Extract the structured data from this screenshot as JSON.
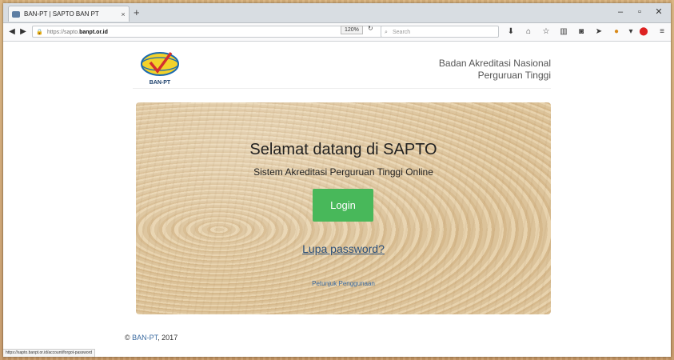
{
  "browser": {
    "tab_title": "BAN-PT | SAPTO BAN PT",
    "tab_close": "×",
    "new_tab": "+",
    "url_prefix": "https://sapto.",
    "url_host": "banpt.or.id",
    "zoom": "120%",
    "search_placeholder": "Search",
    "status_url": "https://sapto.banpt.or.id/account/forgot-password"
  },
  "header": {
    "logo_text": "BAN-PT",
    "org_line1": "Badan Akreditasi Nasional",
    "org_line2": "Perguruan Tinggi"
  },
  "hero": {
    "welcome": "Selamat datang di SAPTO",
    "subtitle": "Sistem Akreditasi Perguruan Tinggi Online",
    "login_label": "Login",
    "forgot_label": "Lupa password?",
    "guide_label": "Petunjuk Penggunaan"
  },
  "footer": {
    "copyright_symbol": "©",
    "org": "BAN-PT",
    "year": ", 2017"
  },
  "colors": {
    "login_button": "#48b85a",
    "link": "#2a4f7a"
  }
}
